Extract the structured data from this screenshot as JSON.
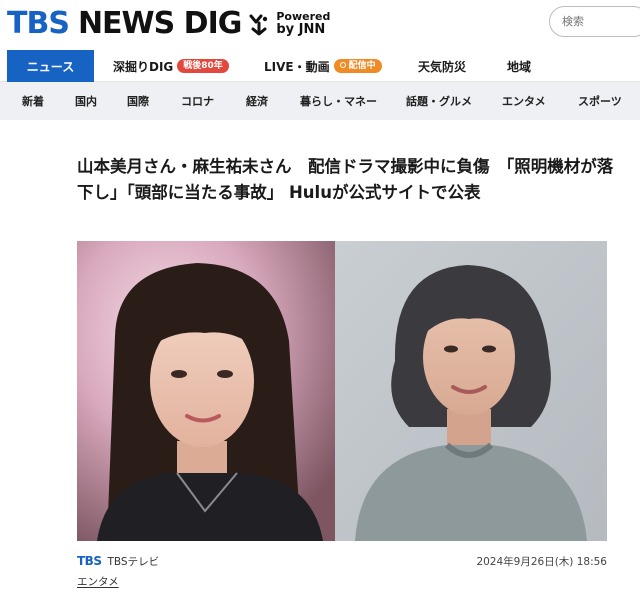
{
  "header": {
    "logo_tbs": "TBS",
    "logo_rest": "NEWS DIG",
    "powered_line1": "Powered",
    "powered_line2": "by JNN",
    "search_placeholder": "検索"
  },
  "primary_nav": [
    {
      "label": "ニュース",
      "active": true
    },
    {
      "label": "深掘りDIG",
      "badge": "戦後80年"
    },
    {
      "label": "LIVE・動画",
      "badge": "配信中"
    },
    {
      "label": "天気防災"
    },
    {
      "label": "地域"
    }
  ],
  "secondary_nav": [
    "新着",
    "国内",
    "国際",
    "コロナ",
    "経済",
    "暮らし・マネー",
    "話題・グルメ",
    "エンタメ",
    "スポーツ"
  ],
  "article": {
    "headline": "山本美月さん・麻生祐未さん　配信ドラマ撮影中に負傷　「照明機材が落下し」「頭部に当たる事故」 Huluが公式サイトで公表",
    "source_logo": "TBS",
    "source_name": "TBSテレビ",
    "date": "2024年9月26日(木) 18:56",
    "category": "エンタメ"
  },
  "colors": {
    "brand_blue": "#1763c4",
    "badge_red": "#e2483d",
    "badge_orange": "#f08a24",
    "subnav_bg": "#eef0f3"
  }
}
